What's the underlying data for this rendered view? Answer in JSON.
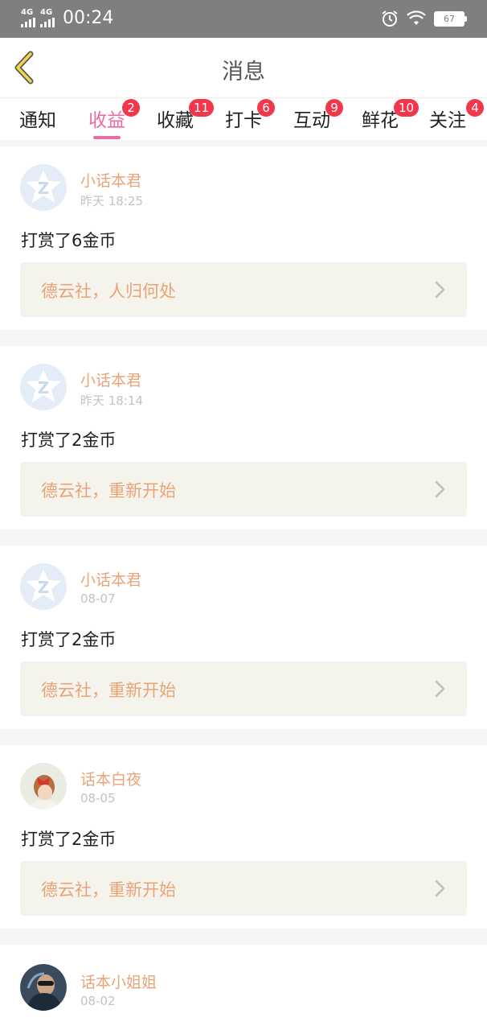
{
  "status_bar": {
    "network_1": "4G",
    "network_2": "4G",
    "time": "00:24",
    "battery": "67"
  },
  "header": {
    "title": "消息",
    "back_icon": "chevron-left-icon"
  },
  "tabs": [
    {
      "label": "通知",
      "badge": ""
    },
    {
      "label": "收益",
      "badge": "2",
      "active": true
    },
    {
      "label": "收藏",
      "badge": "11"
    },
    {
      "label": "打卡",
      "badge": "6"
    },
    {
      "label": "互动",
      "badge": "9"
    },
    {
      "label": "鲜花",
      "badge": "10"
    },
    {
      "label": "关注",
      "badge": "4"
    }
  ],
  "messages": [
    {
      "user": "小话本君",
      "date": "昨天 18:25",
      "text": "打赏了6金币",
      "story": "德云社，人归何处",
      "avatar": "app-logo"
    },
    {
      "user": "小话本君",
      "date": "昨天 18:14",
      "text": "打赏了2金币",
      "story": "德云社，重新开始",
      "avatar": "app-logo"
    },
    {
      "user": "小话本君",
      "date": "08-07",
      "text": "打赏了2金币",
      "story": "德云社，重新开始",
      "avatar": "app-logo"
    },
    {
      "user": "话本白夜",
      "date": "08-05",
      "text": "打赏了2金币",
      "story": "德云社，重新开始",
      "avatar": "photo"
    },
    {
      "user": "话本小姐姐",
      "date": "08-02",
      "text": "",
      "story": "",
      "avatar": "photo"
    }
  ],
  "colors": {
    "accent": "#ef6aa3",
    "badge": "#f2374a",
    "username": "#e9a378",
    "link_bg": "#f4f3ec"
  }
}
